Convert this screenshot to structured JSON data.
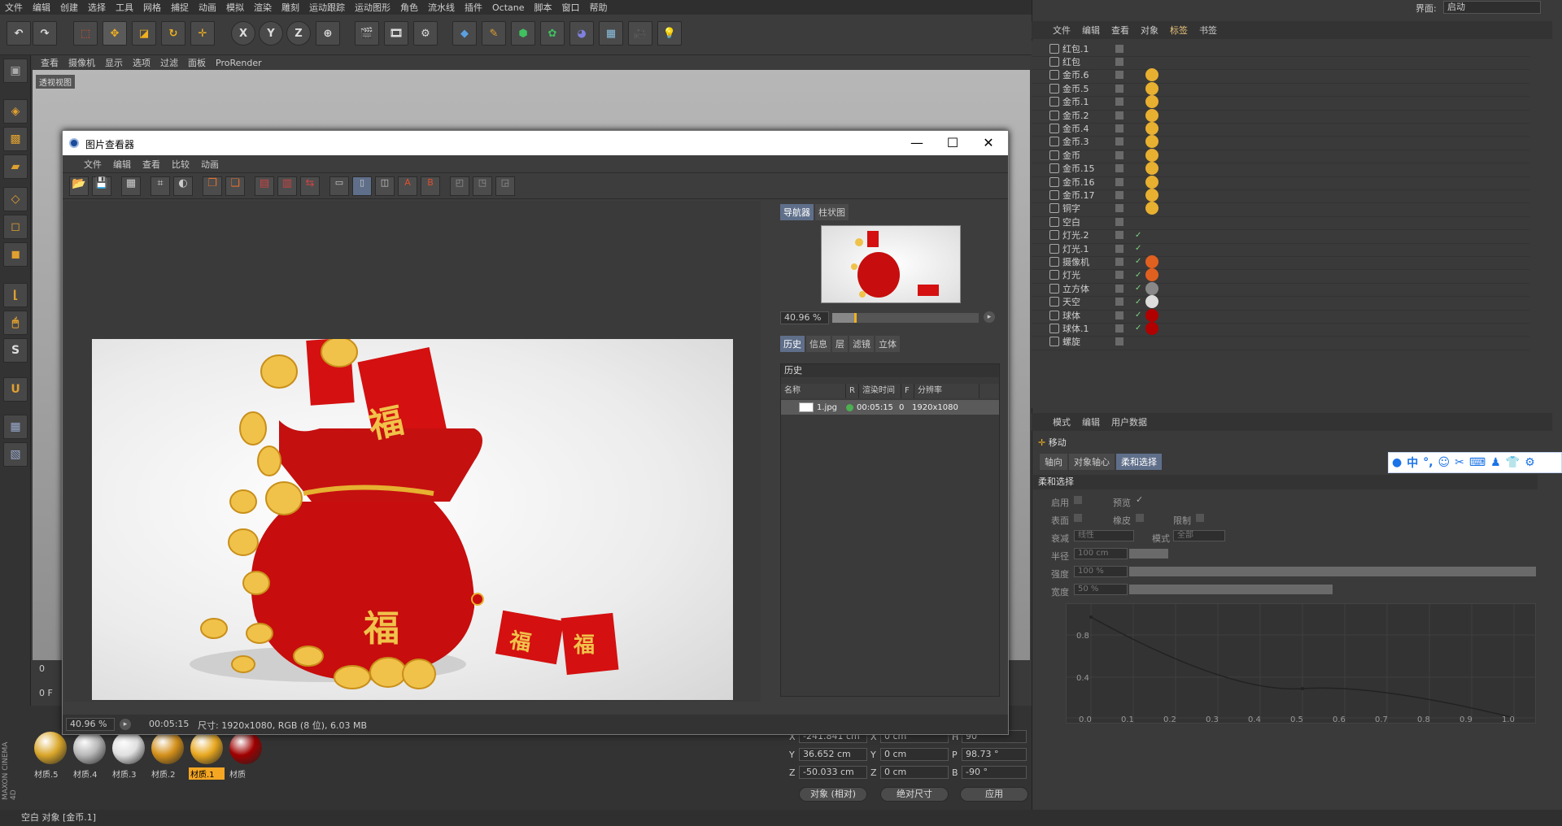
{
  "menubar": [
    "文件",
    "编辑",
    "创建",
    "选择",
    "工具",
    "网格",
    "捕捉",
    "动画",
    "模拟",
    "渲染",
    "雕刻",
    "运动跟踪",
    "运动图形",
    "角色",
    "流水线",
    "插件",
    "Octane",
    "脚本",
    "窗口",
    "帮助"
  ],
  "layout_label": "界面:",
  "layout_value": "启动",
  "toolbar": {
    "x": "X",
    "y": "Y",
    "z": "Z"
  },
  "viewport": {
    "menu": [
      "查看",
      "摄像机",
      "显示",
      "选项",
      "过滤",
      "面板",
      "ProRender"
    ],
    "label": "透视视图"
  },
  "object_manager": {
    "menu": [
      "文件",
      "编辑",
      "查看",
      "对象",
      "标签",
      "书签"
    ],
    "active_menu": "标签",
    "rows": [
      {
        "name": "红包.1",
        "tag": "none"
      },
      {
        "name": "红包",
        "tag": "none"
      },
      {
        "name": "金币.6",
        "tag": "gold"
      },
      {
        "name": "金币.5",
        "tag": "gold"
      },
      {
        "name": "金币.1",
        "tag": "gold"
      },
      {
        "name": "金币.2",
        "tag": "gold"
      },
      {
        "name": "金币.4",
        "tag": "gold"
      },
      {
        "name": "金币.3",
        "tag": "gold"
      },
      {
        "name": "金币",
        "tag": "gold"
      },
      {
        "name": "金币.15",
        "tag": "gold"
      },
      {
        "name": "金币.16",
        "tag": "gold"
      },
      {
        "name": "金币.17",
        "tag": "gold"
      },
      {
        "name": "铜字",
        "tag": "gold"
      },
      {
        "name": "空白",
        "tag": "none"
      },
      {
        "name": "灯光.2",
        "tag": "none"
      },
      {
        "name": "灯光.1",
        "tag": "none"
      },
      {
        "name": "摄像机",
        "tag": "target"
      },
      {
        "name": "灯光",
        "tag": "target"
      },
      {
        "name": "立方体",
        "tag": "checker"
      },
      {
        "name": "天空",
        "tag": "white"
      },
      {
        "name": "球体",
        "tag": "red"
      },
      {
        "name": "球体.1",
        "tag": "red"
      },
      {
        "name": "螺旋",
        "tag": "none"
      }
    ],
    "checkmark": "✓"
  },
  "attributes": {
    "menu": [
      "模式",
      "编辑",
      "用户数据"
    ],
    "title": "移动",
    "tabs": [
      "轴向",
      "对象轴心",
      "柔和选择"
    ],
    "active_tab": "柔和选择",
    "section": "柔和选择",
    "fields": {
      "enable": "启用",
      "preview": "预览",
      "surface": "表面",
      "rubber": "橡皮",
      "limit": "限制",
      "falloff": "衰减",
      "falloff_value": "线性",
      "mode": "模式",
      "mode_value": "全部",
      "radius": "半径",
      "radius_value": "100 cm",
      "strength": "强度",
      "strength_value": "100 %",
      "strength_fill": 1.0,
      "width": "宽度",
      "width_value": "50 %",
      "width_fill": 0.5
    },
    "graph_y": [
      "0.8",
      "0.4"
    ],
    "graph_x": [
      "0.0",
      "0.1",
      "0.2",
      "0.3",
      "0.4",
      "0.5",
      "0.6",
      "0.7",
      "0.8",
      "0.9",
      "1.0"
    ]
  },
  "ime": [
    "中",
    "°,",
    "☺"
  ],
  "picture_viewer": {
    "title": "图片查看器",
    "menu": [
      "文件",
      "编辑",
      "查看",
      "比较",
      "动画"
    ],
    "nav_tabs": [
      "导航器",
      "柱状图"
    ],
    "nav_zoom": "40.96 %",
    "hist_tabs": [
      "历史",
      "信息",
      "层",
      "滤镜",
      "立体"
    ],
    "history": {
      "head": "历史",
      "cols": [
        "名称",
        "R",
        "渲染时间",
        "F",
        "分辨率"
      ],
      "row": {
        "name": "1.jpg",
        "time": "00:05:15",
        "frame": "0",
        "res": "1920x1080"
      }
    },
    "status": {
      "zoom": "40.96 %",
      "time": "00:05:15",
      "info": "尺寸: 1920x1080, RGB (8 位), 6.03 MB"
    },
    "render_chars": [
      "福",
      "福",
      "福",
      "福"
    ]
  },
  "timeline": {
    "frame": "0 F",
    "start": "0"
  },
  "materials": [
    {
      "name": "材质.5",
      "color": "#d9a62a"
    },
    {
      "name": "材质.4",
      "color": "#b8b8b8"
    },
    {
      "name": "材质.3",
      "color": "#e0e0e0"
    },
    {
      "name": "材质.2",
      "color": "#d4901a"
    },
    {
      "name": "材质.1",
      "color": "#e8a820"
    },
    {
      "name": "材质",
      "color": "#a00000"
    }
  ],
  "active_material": "材质.1",
  "coords": {
    "x_label": "X",
    "y_label": "Y",
    "z_label": "Z",
    "x": "-241.841 cm",
    "y": "36.652 cm",
    "z": "-50.033 cm",
    "sx": "0 cm",
    "sy": "0 cm",
    "sz": "0 cm",
    "h_label": "H",
    "p_label": "P",
    "b_label": "B",
    "h": "90 °",
    "p": "98.73 °",
    "b": "-90 °",
    "mode1": "对象 (相对)",
    "mode2": "绝对尺寸",
    "apply": "应用"
  },
  "statusbar": "空白 对象 [金币.1]",
  "brand": "MAXON CINEMA 4D"
}
